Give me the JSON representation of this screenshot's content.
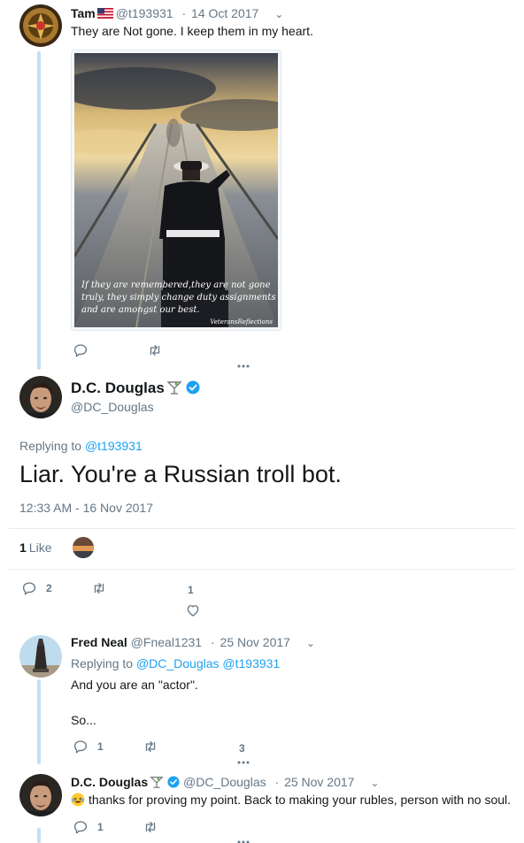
{
  "tweets": [
    {
      "name": "Tam",
      "handle": "@t193931",
      "separator": "·",
      "date": "14 Oct 2017",
      "text": "They are Not gone. I keep them in my heart.",
      "image_caption": "If they are remembered,they are not gone truly, they simply change duty assignments and are amongst our best.",
      "image_credit": "VeteransReflections",
      "replies": "",
      "retweets": "",
      "likes": ""
    },
    {
      "name": "D.C. Douglas",
      "handle": "@DC_Douglas",
      "replying_to_label": "Replying to",
      "replying_to": "@t193931",
      "text": "Liar. You're a Russian troll bot.",
      "timestamp": "12:33 AM - 16 Nov 2017",
      "like_count": "1",
      "like_label": "Like",
      "replies": "2",
      "retweets": "",
      "likes": "1"
    },
    {
      "name": "Fred Neal",
      "handle": "@Fneal1231",
      "separator": "·",
      "date": "25 Nov 2017",
      "replying_to_label": "Replying to",
      "replying_to_1": "@DC_Douglas",
      "replying_to_2": "@t193931",
      "text_line_1": "And you are an \"actor\".",
      "text_line_2": "So...",
      "replies": "1",
      "retweets": "",
      "likes": "3"
    },
    {
      "name": "D.C. Douglas",
      "handle": "@DC_Douglas",
      "separator": "·",
      "date": "25 Nov 2017",
      "text": "thanks for proving my point. Back to making your rubles, person with no soul.",
      "replies": "1",
      "retweets": "",
      "likes": ""
    }
  ],
  "icons": {
    "reply": "reply-icon",
    "retweet": "retweet-icon",
    "like": "heart-icon",
    "more": "more-icon",
    "verified": "verified-badge-icon",
    "flag": "us-flag-icon",
    "cocktail": "cocktail-icon",
    "emoji": "laughing-emoji"
  },
  "colors": {
    "link": "#1da1f2",
    "thread_line": "#c4dff2",
    "muted_text": "#657786",
    "primary_text": "#14171a"
  }
}
